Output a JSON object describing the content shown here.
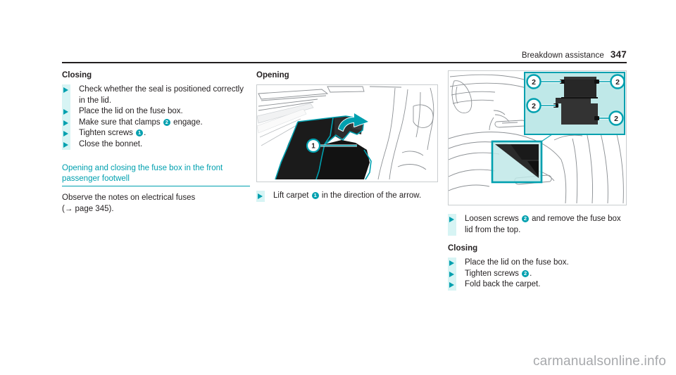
{
  "header": {
    "title": "Breakdown assistance",
    "page_number": "347"
  },
  "colors": {
    "teal": "#00a0af",
    "teal_light": "#d7f4f4",
    "panel_fill": "#bfe8e8",
    "text": "#231f20",
    "rule": "#231f20",
    "watermark": "#a7a9ac"
  },
  "column_left": {
    "subhead": "Closing",
    "steps": [
      {
        "before": "Check whether the seal is positioned correctly in the lid.",
        "badge": "",
        "after": ""
      },
      {
        "before": "Place the lid on the fuse box.",
        "badge": "",
        "after": ""
      },
      {
        "before": "Make sure that clamps ",
        "badge": "2",
        "after": " engage."
      },
      {
        "before": "Tighten screws ",
        "badge": "1",
        "after": "."
      },
      {
        "before": "Close the bonnet.",
        "badge": "",
        "after": ""
      }
    ],
    "section_link": "Opening and closing the fuse box in the front passenger footwell",
    "note_line_1": "Observe the notes on electrical fuses",
    "note_line_2": "(→ page 345)."
  },
  "column_middle": {
    "subhead": "Opening",
    "figure": {
      "name": "front-passenger-footwell-carpet-illustration",
      "callouts": [
        {
          "label": "1"
        }
      ],
      "arrow": "curved-arrow-up-left"
    },
    "steps": [
      {
        "before": "Lift carpet ",
        "badge": "1",
        "after": " in the direction of the arrow."
      }
    ]
  },
  "column_right": {
    "figure": {
      "name": "footwell-fuse-box-lid-illustration",
      "inset_callouts": [
        {
          "label": "2"
        },
        {
          "label": "2"
        },
        {
          "label": "2"
        },
        {
          "label": "2"
        }
      ]
    },
    "steps_top": [
      {
        "before": "Loosen screws ",
        "badge": "2",
        "after": " and remove the fuse box lid from the top."
      }
    ],
    "subhead": "Closing",
    "steps_bottom": [
      {
        "before": "Place the lid on the fuse box.",
        "badge": "",
        "after": ""
      },
      {
        "before": "Tighten screws ",
        "badge": "2",
        "after": "."
      },
      {
        "before": "Fold back the carpet.",
        "badge": "",
        "after": ""
      }
    ]
  },
  "watermark": "carmanualsonline.info"
}
